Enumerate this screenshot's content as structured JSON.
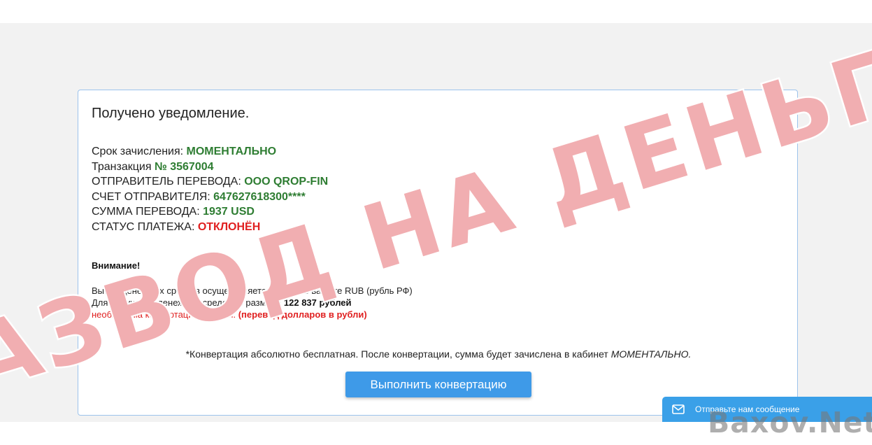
{
  "notification": {
    "title": "Получено уведомление.",
    "details": [
      {
        "label": "Срок зачисления: ",
        "value": "МОМЕНТАЛЬНО",
        "color": "#2e7d32"
      },
      {
        "label": "Транзакция ",
        "value": "№ 3567004",
        "color": "#2e7d32"
      },
      {
        "label": "ОТПРАВИТЕЛЬ ПЕРЕВОДА: ",
        "value": "ООО QROP-FIN",
        "color": "#2e7d32"
      },
      {
        "label": "СЧЕТ ОТПРАВИТЕЛЯ: ",
        "value": "647627618300****",
        "color": "#2e7d32"
      },
      {
        "label": "СУММА ПЕРЕВОДА: ",
        "value": "1937 USD",
        "color": "#2e7d32"
      },
      {
        "label": "СТАТУС ПЛАТЕЖА: ",
        "value": "ОТКЛОНЁН",
        "color": "#e02020"
      }
    ],
    "warning": {
      "title": "Внимание!",
      "line1": "Вывод денежных средств осуществляется только в валюте RUB (рубль РФ)",
      "line2_prefix": "Для получения денежных средств в размере ",
      "line2_amount": "122 837 рублей",
      "line3": "необходима конвертация валюты.",
      "line3_bold": " (перевод долларов в рубли)"
    },
    "note_text": "*Конвертация абсолютно бесплатная. После конвертации, сумма будет зачислена в кабинет ",
    "note_emphasis": "МОМЕНТАЛЬНО.",
    "convert_button": "Выполнить конвертацию"
  },
  "chat_widget": {
    "icon": "envelope-icon",
    "label": "Отправьте нам сообщение"
  },
  "overlay": {
    "stamp_text": "РАЗВОД НА ДЕНЬГИ",
    "watermark": "Baxov.Net"
  },
  "colors": {
    "accent": "#3e9ae8",
    "success": "#2e7d32",
    "danger": "#e02020",
    "card_border": "#9cc3ec"
  }
}
